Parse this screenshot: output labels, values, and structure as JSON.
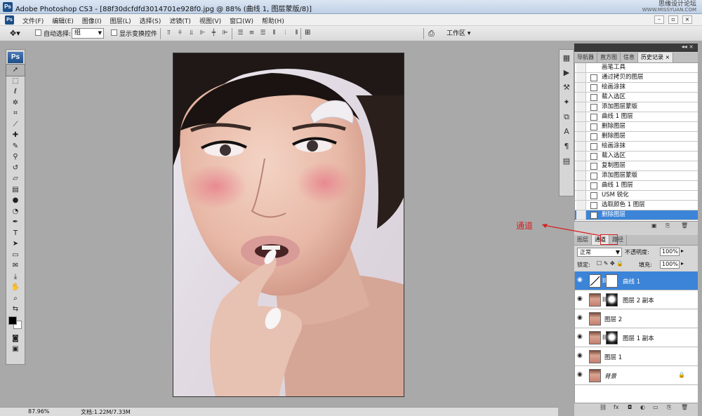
{
  "window": {
    "title": "Adobe Photoshop CS3 - [88f30dcfdfd3014701e928f0.jpg @ 88% (曲线 1, 图层蒙版/8)]",
    "watermark_text": "思缘设计论坛",
    "watermark_url": "WWW.MISSYUAN.COM"
  },
  "menu": [
    "文件(F)",
    "编辑(E)",
    "图像(I)",
    "图层(L)",
    "选择(S)",
    "滤镜(T)",
    "视图(V)",
    "窗口(W)",
    "帮助(H)"
  ],
  "options": {
    "auto_select_label": "自动选择:",
    "auto_select_value": "组",
    "show_transform_label": "显示变换控件",
    "workspace_label": "工作区"
  },
  "history_panel": {
    "tabs": [
      "导航器",
      "直方图",
      "信息",
      "历史记录"
    ],
    "items": [
      "画笔工具",
      "通过拷贝的图层",
      "绘画涂抹",
      "载入选区",
      "添加图层蒙版",
      "曲线 1 图层",
      "删除图层",
      "删除图层",
      "绘画涂抹",
      "载入选区",
      "复制图层",
      "添加图层蒙版",
      "曲线 1 图层",
      "USM 锐化",
      "选取颜色 1 图层",
      "删除图层"
    ]
  },
  "layers_panel": {
    "tabs": [
      "图层",
      "通道",
      "路径"
    ],
    "blend_mode": "正常",
    "opacity_label": "不透明度:",
    "opacity_value": "100%",
    "lock_label": "锁定:",
    "fill_label": "填充:",
    "fill_value": "100%",
    "layers": [
      {
        "name": "曲线 1",
        "has_mask": true,
        "type": "adjustment"
      },
      {
        "name": "图层 2 副本",
        "has_mask": true,
        "type": "pixel"
      },
      {
        "name": "图层 2",
        "has_mask": false,
        "type": "pixel"
      },
      {
        "name": "图层 1 副本",
        "has_mask": true,
        "type": "pixel"
      },
      {
        "name": "图层 1",
        "has_mask": false,
        "type": "pixel"
      },
      {
        "name": "背景",
        "has_mask": false,
        "type": "background"
      }
    ]
  },
  "status": {
    "zoom": "87.96%",
    "doc_size": "文档:1.22M/7.33M"
  },
  "annotation": {
    "label": "通道"
  },
  "colors": {
    "selection_blue": "#3b84d8",
    "annotation_red": "#d72020"
  }
}
